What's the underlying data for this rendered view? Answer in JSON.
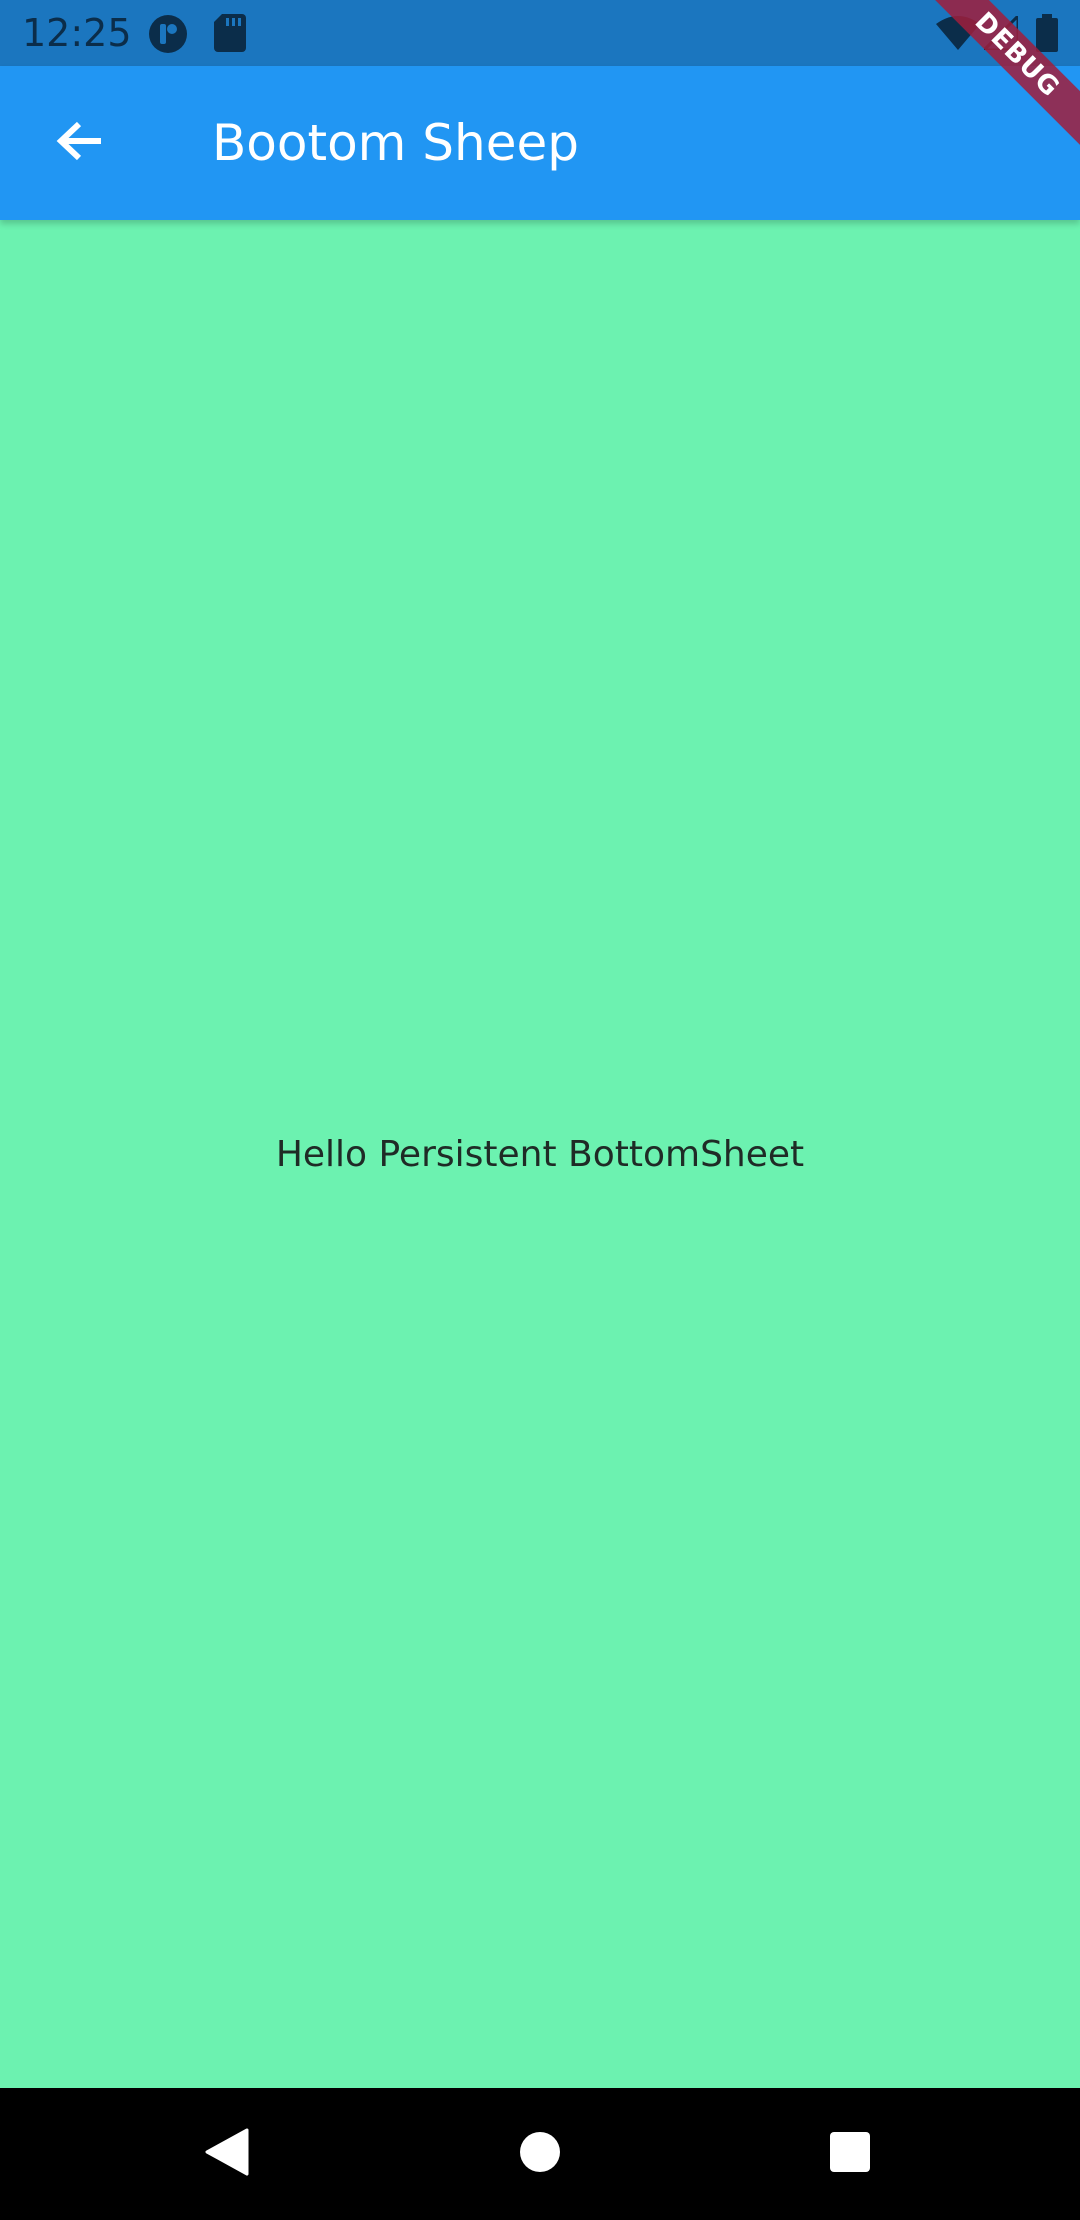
{
  "status_bar": {
    "time": "12:25",
    "icons": [
      "app-notification-icon",
      "sd-card-icon",
      "wifi-icon",
      "signal-icon",
      "battery-icon"
    ]
  },
  "app_bar": {
    "title": "Bootom Sheep",
    "back_icon": "arrow-back-icon",
    "color": "#2196f3"
  },
  "content": {
    "message": "Hello Persistent BottomSheet",
    "background_color": "#6cf2b0"
  },
  "debug_banner": {
    "label": "DEBUG"
  },
  "nav_bar": {
    "buttons": [
      "back-triangle-icon",
      "home-circle-icon",
      "recents-square-icon"
    ]
  }
}
